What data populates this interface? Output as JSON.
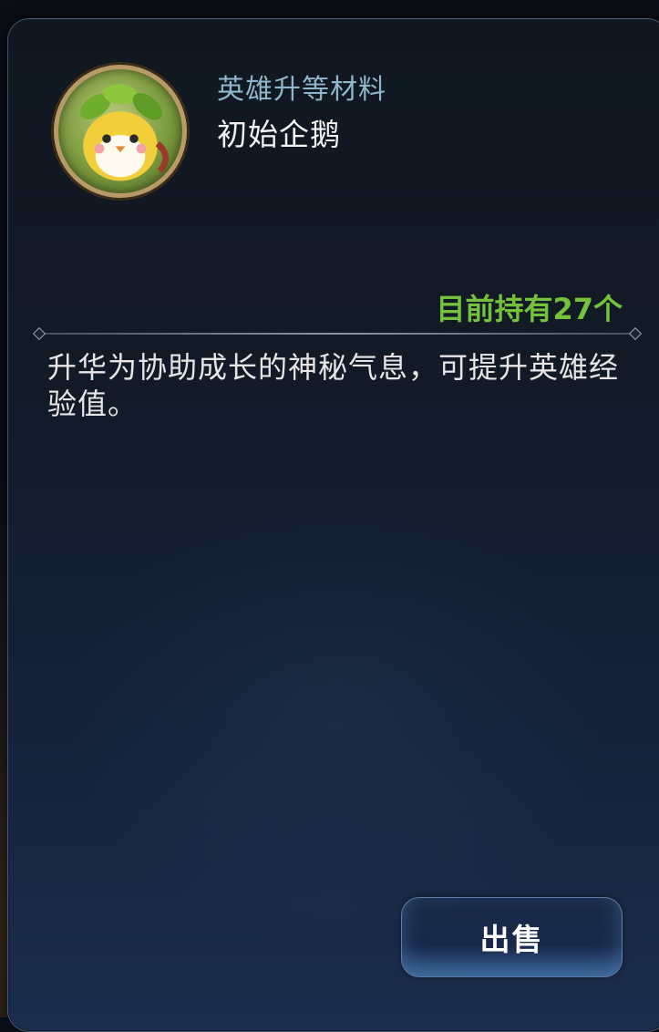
{
  "item": {
    "category": "英雄升等材料",
    "name": "初始企鹅",
    "icon": "penguin-with-leaf-crown-icon"
  },
  "owned_text": "目前持有27个",
  "description": "升华为协助成长的神秘气息，可提升英雄经验值。",
  "actions": {
    "sell_label": "出售"
  },
  "colors": {
    "owned_text": "#74c23b",
    "category_text": "#8fb7c9",
    "panel_border": "#6e82a0",
    "avatar_ring": "#b89968"
  }
}
